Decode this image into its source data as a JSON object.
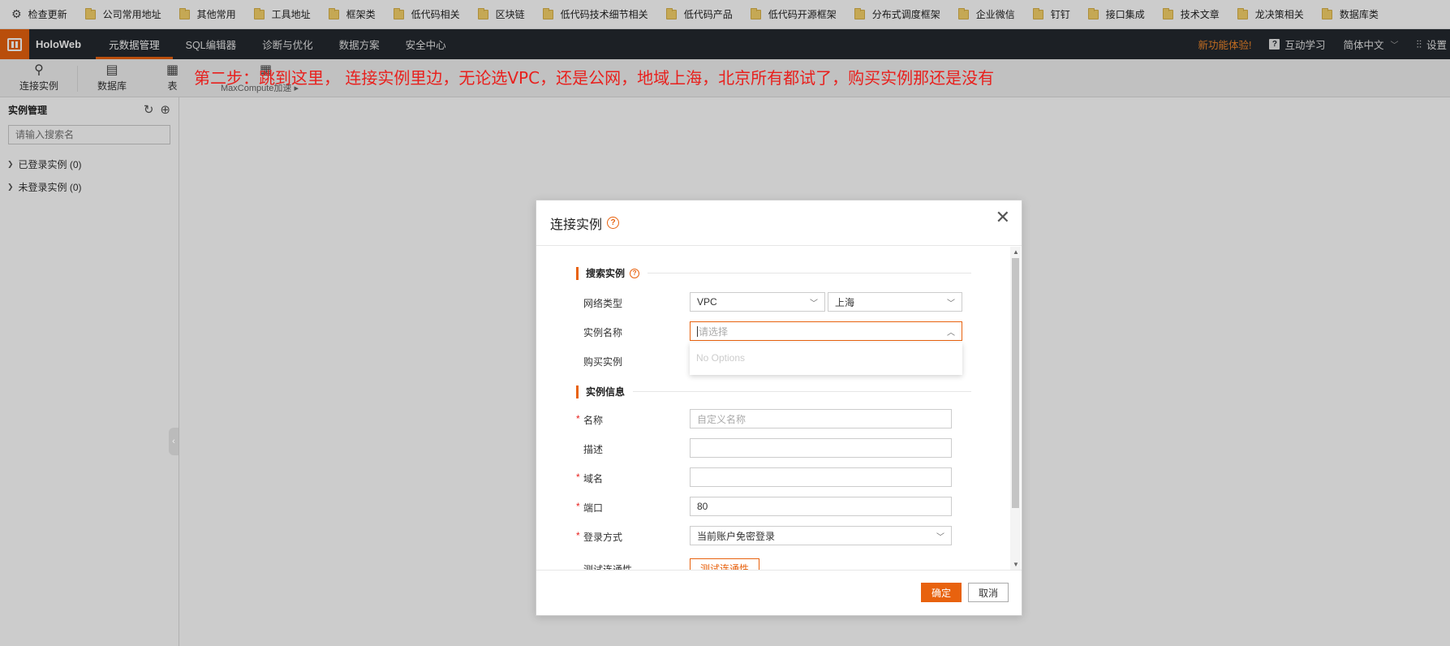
{
  "bookmarks": {
    "first": "检查更新",
    "items": [
      "公司常用地址",
      "其他常用",
      "工具地址",
      "框架类",
      "低代码相关",
      "区块链",
      "低代码技术细节相关",
      "低代码产品",
      "低代码开源框架",
      "分布式调度框架",
      "企业微信",
      "钉钉",
      "接口集成",
      "技术文章",
      "龙决策相关",
      "数据库类"
    ]
  },
  "appbar": {
    "app_name": "HoloWeb",
    "nav": [
      "元数据管理",
      "SQL编辑器",
      "诊断与优化",
      "数据方案",
      "安全中心"
    ],
    "new_feature": "新功能体验!",
    "learn": "互动学习",
    "language": "简体中文",
    "settings": "设置"
  },
  "toolbar": {
    "connect": "连接实例",
    "database": "数据库",
    "table": "表",
    "mc_accel": "MaxCompute加速"
  },
  "annotation": "第二步：跳到这里， 连接实例里边，无论选VPC，还是公网，地域上海，北京所有都试了，购买实例那还是没有",
  "sidebar": {
    "title": "实例管理",
    "search_placeholder": "请输入搜索名",
    "tree": [
      "已登录实例 (0)",
      "未登录实例 (0)"
    ]
  },
  "dialog": {
    "title": "连接实例",
    "section_search": "搜索实例",
    "network_label": "网络类型",
    "network_value": "VPC",
    "region_value": "上海",
    "instance_label": "实例名称",
    "instance_placeholder": "请选择",
    "no_options": "No Options",
    "buy_label": "购买实例",
    "section_info": "实例信息",
    "name_label": "名称",
    "name_placeholder": "自定义名称",
    "desc_label": "描述",
    "domain_label": "域名",
    "port_label": "端口",
    "port_value": "80",
    "login_label": "登录方式",
    "login_value": "当前账户免密登录",
    "test_label": "测试连通性",
    "test_button": "测试连通性",
    "ok": "确定",
    "cancel": "取消"
  },
  "colors": {
    "accent": "#e8620e",
    "annotation": "#e8201d",
    "header_bg": "#24292f"
  }
}
